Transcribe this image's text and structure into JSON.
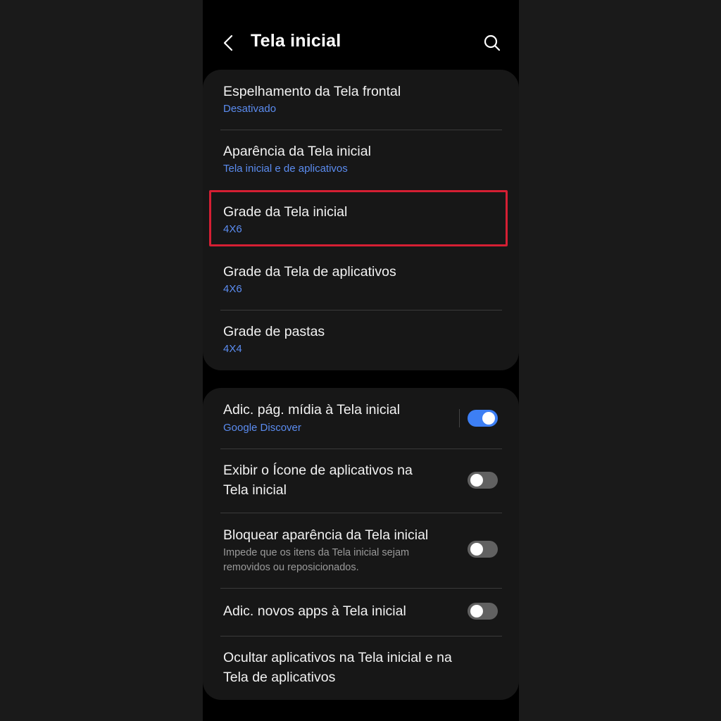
{
  "header": {
    "title": "Tela inicial"
  },
  "section1": {
    "items": [
      {
        "label": "Espelhamento da Tela frontal",
        "sub": "Desativado"
      },
      {
        "label": "Aparência da Tela inicial",
        "sub": "Tela inicial e de aplicativos"
      },
      {
        "label": "Grade da Tela inicial",
        "sub": "4X6"
      },
      {
        "label": "Grade da Tela de aplicativos",
        "sub": "4X6"
      },
      {
        "label": "Grade de pastas",
        "sub": "4X4"
      }
    ]
  },
  "section2": {
    "items": [
      {
        "label": "Adic. pág. mídia à Tela inicial",
        "sub": "Google Discover",
        "toggle": true
      },
      {
        "label_line1": "Exibir o Ícone de aplicativos na",
        "label_line2": "Tela inicial",
        "toggle": false
      },
      {
        "label": "Bloquear aparência da Tela inicial",
        "desc_line1": "Impede que os itens da Tela inicial sejam",
        "desc_line2": "removidos ou reposicionados.",
        "toggle": false
      },
      {
        "label": "Adic. novos apps à Tela inicial",
        "toggle": false
      },
      {
        "label_line1": "Ocultar aplicativos na Tela inicial e na",
        "label_line2": "Tela de aplicativos"
      }
    ]
  },
  "colors": {
    "background": "#000000",
    "card": "#171717",
    "accent": "#5b8cf0",
    "toggle_on": "#3d7ff4",
    "toggle_off": "#616161",
    "highlight": "#d51f33"
  },
  "icons": {
    "back": "back-arrow-icon",
    "search": "search-icon"
  }
}
